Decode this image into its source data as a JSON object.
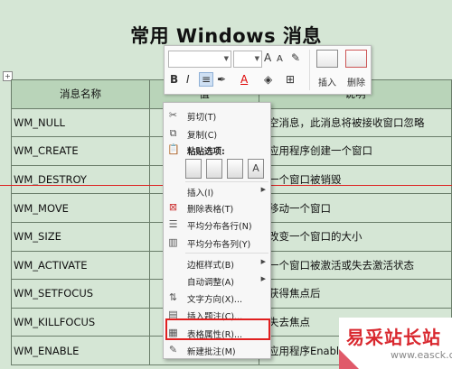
{
  "doc": {
    "title": "常用 Windows 消息",
    "move_handle": "+"
  },
  "table": {
    "headers": [
      "消息名称",
      "值",
      "说明"
    ],
    "rows": [
      [
        "WM_NULL",
        "",
        "空消息，此消息将被接收窗口忽略"
      ],
      [
        "WM_CREATE",
        "",
        "应用程序创建一个窗口"
      ],
      [
        "WM_DESTROY",
        "",
        "一个窗口被销毁"
      ],
      [
        "WM_MOVE",
        "",
        "移动一个窗口"
      ],
      [
        "WM_SIZE",
        "",
        "改变一个窗口的大小"
      ],
      [
        "WM_ACTIVATE",
        "",
        "一个窗口被激活或失去激活状态"
      ],
      [
        "WM_SETFOCUS",
        "",
        "获得焦点后"
      ],
      [
        "WM_KILLFOCUS",
        "",
        "失去焦点"
      ],
      [
        "WM_ENABLE",
        "",
        "应用程序Enable"
      ]
    ]
  },
  "mini_toolbar": {
    "bold": "B",
    "italic": "I",
    "font_grow": "A",
    "font_shrink": "A",
    "font_color": "A",
    "insert_label": "插入",
    "delete_label": "删除"
  },
  "context_menu": {
    "items": [
      {
        "label": "剪切(T)",
        "icon": "scissors-icon",
        "glyph": "✂"
      },
      {
        "label": "复制(C)",
        "icon": "copy-icon",
        "glyph": "⧉"
      },
      {
        "label": "粘贴选项:",
        "icon": "paste-icon",
        "glyph": "📋"
      },
      {
        "label": "插入(I)",
        "icon": "",
        "glyph": "",
        "submenu": true
      },
      {
        "label": "删除表格(T)",
        "icon": "delete-table-icon",
        "glyph": "⊠"
      },
      {
        "label": "平均分布各行(N)",
        "icon": "distribute-rows-icon",
        "glyph": "☰"
      },
      {
        "label": "平均分布各列(Y)",
        "icon": "distribute-columns-icon",
        "glyph": "▥"
      },
      {
        "label": "边框样式(B)",
        "icon": "",
        "glyph": "",
        "submenu": true
      },
      {
        "label": "自动调整(A)",
        "icon": "",
        "glyph": "",
        "submenu": true
      },
      {
        "label": "文字方向(X)...",
        "icon": "text-direction-icon",
        "glyph": "⇅"
      },
      {
        "label": "插入题注(C)...",
        "icon": "insert-caption-icon",
        "glyph": "▤"
      },
      {
        "label": "表格属性(R)...",
        "icon": "table-properties-icon",
        "glyph": "▦",
        "highlighted": true
      },
      {
        "label": "新建批注(M)",
        "icon": "new-comment-icon",
        "glyph": "✎"
      }
    ]
  },
  "watermark": {
    "text": "易采站长站",
    "url": "www.easck.com"
  },
  "colors": {
    "page_bg": "#d5e6d5",
    "header_bg": "#b9d4b9",
    "highlight": "#e02020",
    "watermark": "#d9282f"
  }
}
